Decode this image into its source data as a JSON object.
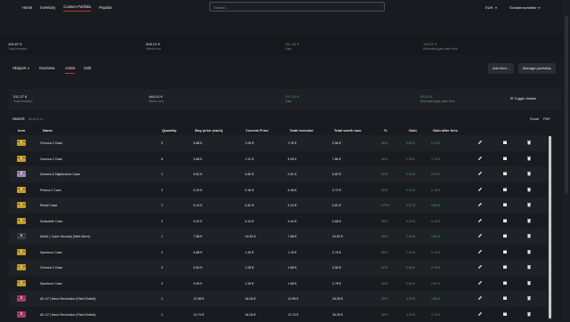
{
  "nav": {
    "items": [
      "Home",
      "Inventory",
      "Custom Portfolio",
      "Popular"
    ],
    "active_index": 2,
    "search_placeholder": "Search...",
    "currency": "EUR",
    "user": "Schaltenschlötter"
  },
  "summary_top": {
    "total_invested": {
      "value": "426.67 €",
      "label": "Total invested"
    },
    "worth_now": {
      "value": "608.12 €",
      "label": "Worth now"
    },
    "gain": {
      "value": "181.45 €",
      "label": "Gain"
    },
    "gain_after_fees": {
      "value": "155.20 €",
      "label": "Estimated gain after fees"
    }
  },
  "tabs": {
    "source": "Skinport",
    "items": [
      "Overview",
      "Active",
      "Sold"
    ],
    "active_index": 1,
    "add_item": "Add item...",
    "manage": "Manage portfolios"
  },
  "summary_active": {
    "total_invested": {
      "value": "311.27 €",
      "label": "Total invested"
    },
    "worth_now": {
      "value": "448.41 €",
      "label": "Worth now"
    },
    "gain": {
      "value": "137.14 €",
      "label": "Gain"
    },
    "gain_after_fees": {
      "value": "93.53 €",
      "label": "Estimated gain after fees"
    },
    "toggle": "Toggle details"
  },
  "table": {
    "search_label": "Search:",
    "search_placeholder": "Search in...",
    "export_excel": "Excel",
    "export_pdf": "PDF",
    "headers": [
      "Icon",
      "Name",
      "Quantity",
      "Buy price (each)",
      "Current Price",
      "Total invested",
      "Total worth now",
      "%",
      "Gain",
      "Gain after fees"
    ],
    "rows": [
      {
        "name": "Chroma 2 Case",
        "qty": "2",
        "buy": "0.88 €",
        "cur": "1.28 €",
        "inv": "1.76 €",
        "worth": "2.56 €",
        "pct": "45%",
        "gain": "0.80 €",
        "gaf": "0.74 €",
        "color": "#c79a2a"
      },
      {
        "name": "Gamma 2 Case",
        "qty": "6",
        "buy": "0.88 €",
        "cur": "1.31 €",
        "inv": "5.28 €",
        "worth": "7.86 €",
        "pct": "49%",
        "gain": "2.58 €",
        "gaf": "1.79 €",
        "color": "#c79a2a"
      },
      {
        "name": "Dreams & Nightmares Case",
        "qty": "1",
        "buy": "0.51 €",
        "cur": "0.82 €",
        "inv": "0.51 €",
        "worth": "0.82 €",
        "pct": "61%",
        "gain": "0.31 €",
        "gaf": "0.22 €",
        "color": "#9a8ab0"
      },
      {
        "name": "Prisma 2 Case",
        "qty": "2",
        "buy": "0.24 €",
        "cur": "0.36 €",
        "inv": "0.48 €",
        "worth": "0.72 €",
        "pct": "50%",
        "gain": "0.24 €",
        "gaf": "0.18 €",
        "color": "#c79a2a"
      },
      {
        "name": "Recoil Case",
        "qty": "1",
        "buy": "0.14 €",
        "cur": "0.81 €",
        "inv": "0.14 €",
        "worth": "0.81 €",
        "pct": "479%",
        "gain": "0.67 €",
        "gaf": "0.59 €",
        "color": "#c79a2a"
      },
      {
        "name": "Snakebite Case",
        "qty": "2",
        "buy": "0.22 €",
        "cur": "0.34 €",
        "inv": "0.44 €",
        "worth": "0.68 €",
        "pct": "55%",
        "gain": "0.24 €",
        "gaf": "0.15 €",
        "color": "#c79a2a"
      },
      {
        "name": "M4A4 | Cyber Security (Well-Worn)",
        "qty": "1",
        "buy": "7.58 €",
        "cur": "10.52 €",
        "inv": "7.58 €",
        "worth": "10.52 €",
        "pct": "39%",
        "gain": "2.94 €",
        "gaf": "1.69 €",
        "color": "#3a3f47"
      },
      {
        "name": "Spectrum Case",
        "qty": "2",
        "buy": "0.88 €",
        "cur": "1.39 €",
        "inv": "1.76 €",
        "worth": "2.78 €",
        "pct": "58%",
        "gain": "1.02 €",
        "gaf": "0.78 €",
        "color": "#c79a2a"
      },
      {
        "name": "Chroma 2 Case",
        "qty": "2",
        "buy": "0.84 €",
        "cur": "1.28 €",
        "inv": "1.68 €",
        "worth": "2.56 €",
        "pct": "52%",
        "gain": "0.88 €",
        "gaf": "0.76 €",
        "color": "#c79a2a"
      },
      {
        "name": "Spectrum Case",
        "qty": "2",
        "buy": "0.99 €",
        "cur": "1.39 €",
        "inv": "1.98 €",
        "worth": "2.78 €",
        "pct": "40%",
        "gain": "0.80 €",
        "gaf": "0.62 €",
        "color": "#c79a2a"
      },
      {
        "name": "AK-47 | Neon Revolution (Field-Tested)",
        "qty": "1",
        "buy": "12.98 €",
        "cur": "16.28 €",
        "inv": "12.98 €",
        "worth": "16.28 €",
        "pct": "25%",
        "gain": "3.30 €",
        "gaf": "1.86 €",
        "color": "#b03a6a"
      },
      {
        "name": "AK-47 | Neon Revolution (Field-Tested)",
        "qty": "1",
        "buy": "12.74 €",
        "cur": "16.28 €",
        "inv": "12.74 €",
        "worth": "16.28 €",
        "pct": "28%",
        "gain": "3.54 €",
        "gaf": "2.10 €",
        "color": "#b03a6a"
      }
    ]
  },
  "colors": {
    "accent": "#c8372d",
    "green": "#45a845",
    "bg": "#181b1f"
  }
}
